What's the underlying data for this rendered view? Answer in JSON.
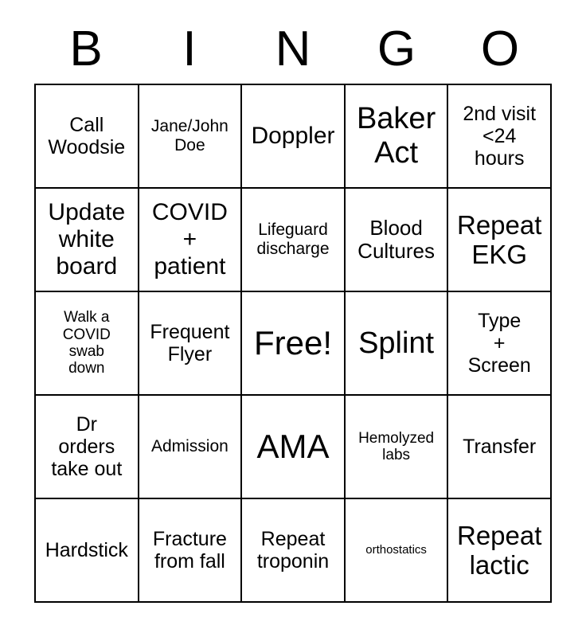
{
  "card": {
    "title": "BINGO",
    "header_letters": [
      "B",
      "I",
      "N",
      "G",
      "O"
    ],
    "free_space_label": "Free!",
    "grid": {
      "rows": 5,
      "columns": 5,
      "border_color": "#000000",
      "background_color": "#ffffff",
      "text_color": "#000000"
    },
    "squares": [
      [
        {
          "text": "Call\nWoodsie",
          "size": "fs-m"
        },
        {
          "text": "Jane/John\nDoe",
          "size": "fs-sm"
        },
        {
          "text": "Doppler",
          "size": "fs-l"
        },
        {
          "text": "Baker\nAct",
          "size": "fs-xxl"
        },
        {
          "text": "2nd visit\n<24\nhours",
          "size": "fs-m"
        }
      ],
      [
        {
          "text": "Update\nwhite\nboard",
          "size": "fs-l"
        },
        {
          "text": "COVID\n+\npatient",
          "size": "fs-l"
        },
        {
          "text": "Lifeguard\ndischarge",
          "size": "fs-sm"
        },
        {
          "text": "Blood\nCultures",
          "size": "fs-ml"
        },
        {
          "text": "Repeat\nEKG",
          "size": "fs-xl"
        }
      ],
      [
        {
          "text": "Walk a\nCOVID\nswab\ndown",
          "size": "fs-s"
        },
        {
          "text": "Frequent\nFlyer",
          "size": "fs-m"
        },
        {
          "text": "Free!",
          "size": "fs-huge"
        },
        {
          "text": "Splint",
          "size": "fs-xxl"
        },
        {
          "text": "Type\n+\nScreen",
          "size": "fs-m"
        }
      ],
      [
        {
          "text": "Dr\norders\ntake out",
          "size": "fs-m"
        },
        {
          "text": "Admission",
          "size": "fs-sm"
        },
        {
          "text": "AMA",
          "size": "fs-huge"
        },
        {
          "text": "Hemolyzed\nlabs",
          "size": "fs-s"
        },
        {
          "text": "Transfer",
          "size": "fs-m"
        }
      ],
      [
        {
          "text": "Hardstick",
          "size": "fs-m"
        },
        {
          "text": "Fracture\nfrom fall",
          "size": "fs-m"
        },
        {
          "text": "Repeat\ntroponin",
          "size": "fs-m"
        },
        {
          "text": "orthostatics",
          "size": "fs-xs"
        },
        {
          "text": "Repeat\nlactic",
          "size": "fs-xl"
        }
      ]
    ]
  }
}
